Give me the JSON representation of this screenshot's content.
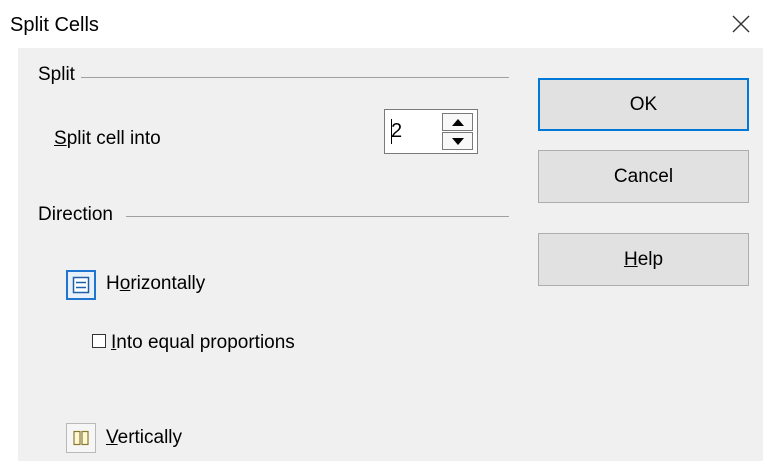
{
  "window": {
    "title": "Split Cells"
  },
  "split": {
    "section_label": "Split",
    "field_label_mnemonic": "S",
    "field_label_rest": "plit cell into",
    "value": "2"
  },
  "direction": {
    "section_label": "Direction",
    "horizontal": {
      "pre": "H",
      "mnemonic": "o",
      "rest": "rizontally",
      "selected": true,
      "icon": "split-horizontal-icon"
    },
    "equal": {
      "mnemonic": "I",
      "rest": "nto equal proportions",
      "checked": false
    },
    "vertical": {
      "mnemonic": "V",
      "rest": "ertically",
      "selected": false,
      "icon": "split-vertical-icon"
    }
  },
  "buttons": {
    "ok": "OK",
    "cancel": "Cancel",
    "help_mnemonic": "H",
    "help_rest": "elp"
  },
  "colors": {
    "accent": "#0078d7",
    "panel": "#f0f0f0"
  }
}
